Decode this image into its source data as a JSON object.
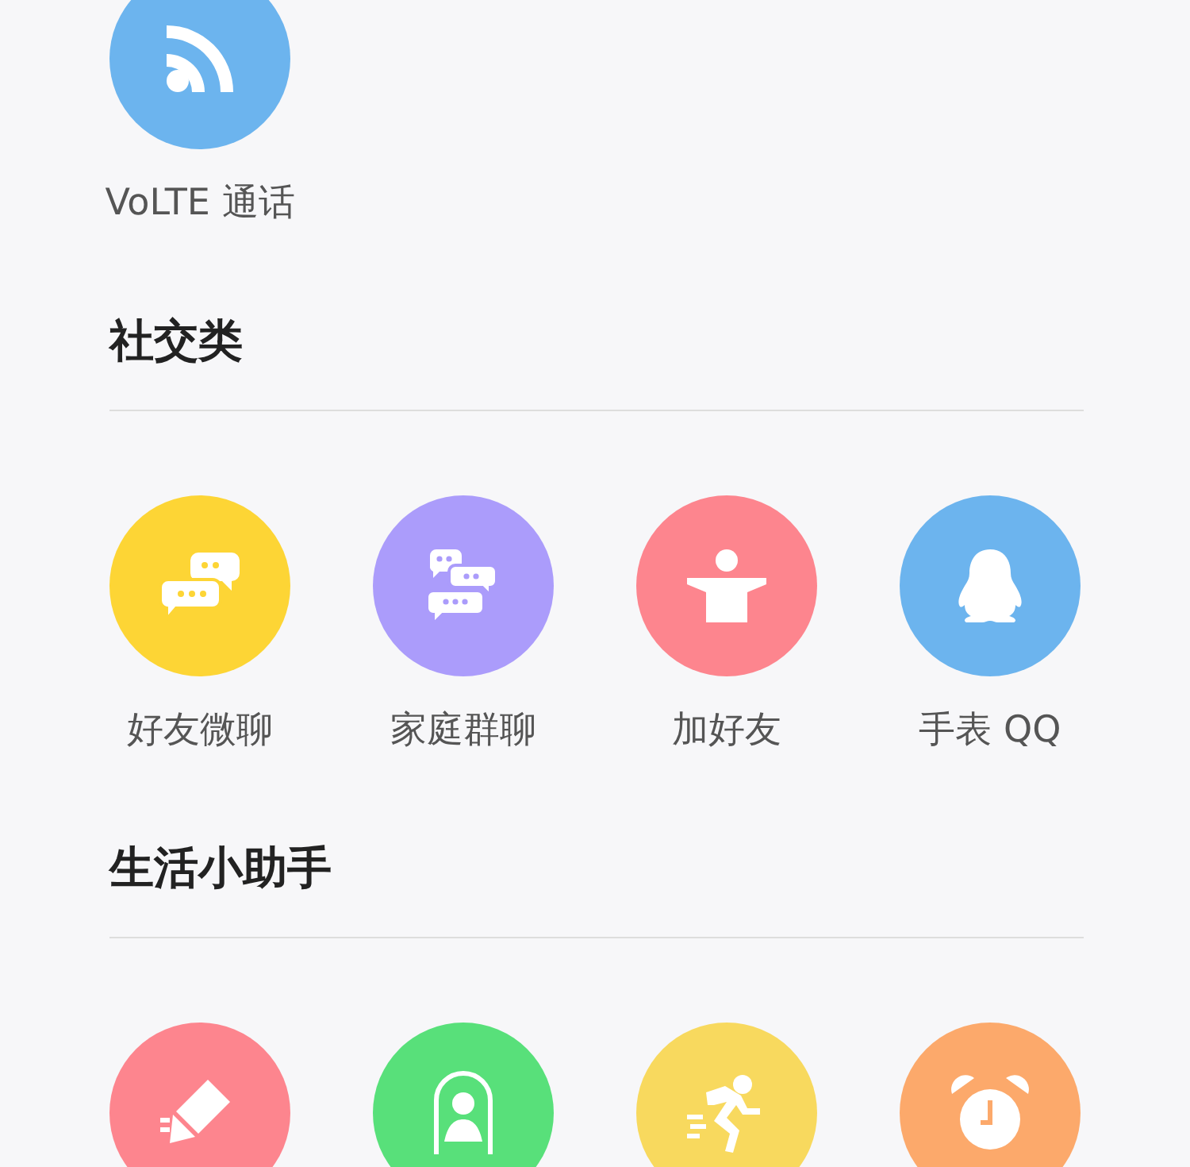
{
  "sections": [
    {
      "items": [
        {
          "kind": "signal",
          "color": "#6cb4ee",
          "label": "VoLTE 通话"
        }
      ]
    },
    {
      "title": "社交类",
      "items": [
        {
          "kind": "chat",
          "color": "#fdd535",
          "label": "好友微聊"
        },
        {
          "kind": "group-chat",
          "color": "#ab9cfb",
          "label": "家庭群聊"
        },
        {
          "kind": "add-friend",
          "color": "#fd858e",
          "label": "加好友"
        },
        {
          "kind": "penguin",
          "color": "#6cb4ee",
          "label": "手表 QQ"
        }
      ]
    },
    {
      "title": "生活小助手",
      "items": [
        {
          "kind": "pencil",
          "color": "#fd858e"
        },
        {
          "kind": "person-card",
          "color": "#58e07a"
        },
        {
          "kind": "runner",
          "color": "#f8d95e"
        },
        {
          "kind": "alarm",
          "color": "#fca96b"
        }
      ]
    }
  ]
}
